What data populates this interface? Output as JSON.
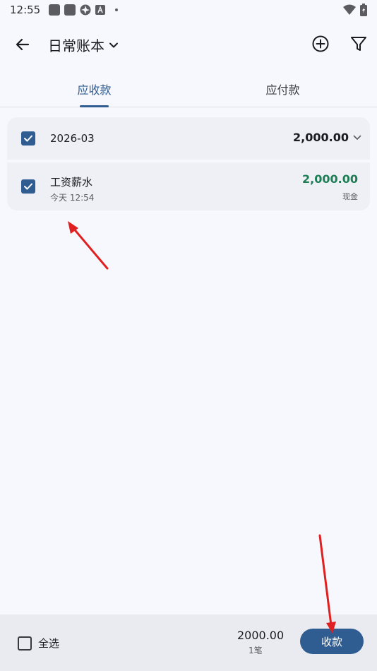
{
  "status_bar": {
    "time": "12:55"
  },
  "app_bar": {
    "title": "日常账本",
    "back_icon": "arrow-left-icon",
    "add_icon": "add-circle-icon",
    "filter_icon": "filter-icon"
  },
  "tabs": [
    {
      "label": "应收款",
      "active": true
    },
    {
      "label": "应付款",
      "active": false
    }
  ],
  "group": {
    "month": "2026-03",
    "amount": "2,000.00",
    "checked": true
  },
  "entries": [
    {
      "title": "工资薪水",
      "time": "今天 12:54",
      "amount": "2,000.00",
      "account": "现金",
      "checked": true
    }
  ],
  "bottom_bar": {
    "select_all_label": "全选",
    "total_amount": "2000.00",
    "count_label": "1笔",
    "collect_label": "收款"
  },
  "colors": {
    "accent": "#2f5d92",
    "income": "#1e7d55",
    "annotation_arrow": "#e02020"
  }
}
